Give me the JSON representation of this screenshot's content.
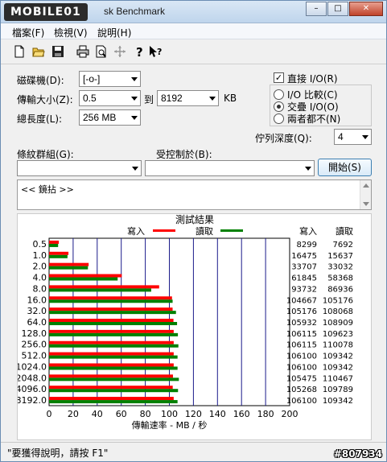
{
  "window": {
    "logo_text": "MOBILE01",
    "title_visible": "sk Benchmark",
    "controls": [
      "–",
      "□",
      "✕"
    ]
  },
  "menu": [
    {
      "label": "檔案(F)"
    },
    {
      "label": "檢視(V)"
    },
    {
      "label": "說明(H)"
    }
  ],
  "toolbar": {
    "icons": [
      "new-file-icon",
      "open-folder-icon",
      "save-icon",
      "print-icon",
      "print-preview-icon",
      "move-icon",
      "help-icon",
      "context-help-icon"
    ]
  },
  "form": {
    "drive_label": "磁碟機(D):",
    "drive_value": "[-o-]",
    "transfer_size_label": "傳輸大小(Z):",
    "transfer_from": "0.5",
    "to_label": "到",
    "transfer_to": "8192",
    "kb_label": "KB",
    "total_length_label": "總長度(L):",
    "total_length_value": "256 MB",
    "direct_io_label": "直接 I/O(R)",
    "direct_io_checked": true,
    "io_compare_label": "I/O 比較(C)",
    "overlapped_io_label": "交疊 I/O(O)",
    "neither_label": "兩者都不(N)",
    "queue_depth_label": "佇列深度(Q):",
    "queue_depth_value": "4",
    "stripe_group_label": "條紋群組(G):",
    "controlled_by_label": "受控制於(B):",
    "start_button": "開始(S)",
    "log_text": "<< 鏡拈 >>"
  },
  "chart_data": {
    "type": "bar",
    "orientation": "horizontal",
    "title": "測試結果",
    "xlabel": "傳輸速率 - MB / 秒",
    "xlim": [
      0,
      200
    ],
    "xticks": [
      "0",
      "20",
      "40",
      "60",
      "80",
      "100",
      "120",
      "140",
      "160",
      "180",
      "200"
    ],
    "categories": [
      "0.5",
      "1.0",
      "2.0",
      "4.0",
      "8.0",
      "16.0",
      "32.0",
      "64.0",
      "128.0",
      "256.0",
      "512.0",
      "1024.0",
      "2048.0",
      "4096.0",
      "8192.0"
    ],
    "write_col_header": "寫入",
    "read_col_header": "讀取",
    "series": [
      {
        "name": "寫入",
        "color": "#ff0000",
        "values_kb": [
          8299,
          16475,
          33707,
          61845,
          93732,
          104667,
          105176,
          105932,
          106115,
          106115,
          106100,
          106100,
          105475,
          105268,
          106100
        ],
        "values": [
          8.1,
          16.1,
          32.9,
          60.4,
          91.5,
          102.2,
          102.7,
          103.4,
          103.6,
          103.6,
          103.6,
          103.6,
          103.0,
          102.8,
          103.6
        ]
      },
      {
        "name": "讀取",
        "color": "#008000",
        "values_kb": [
          7692,
          15637,
          33032,
          58368,
          86936,
          105176,
          108068,
          108909,
          109623,
          110078,
          109342,
          109342,
          110467,
          109789,
          109342
        ],
        "values": [
          7.5,
          15.3,
          32.3,
          57.0,
          84.9,
          102.7,
          105.5,
          106.4,
          107.1,
          107.5,
          106.8,
          106.8,
          107.9,
          107.2,
          106.8
        ]
      }
    ]
  },
  "status": {
    "text": "\"要獲得說明，請按 F1\"",
    "watermark": "#807934"
  }
}
